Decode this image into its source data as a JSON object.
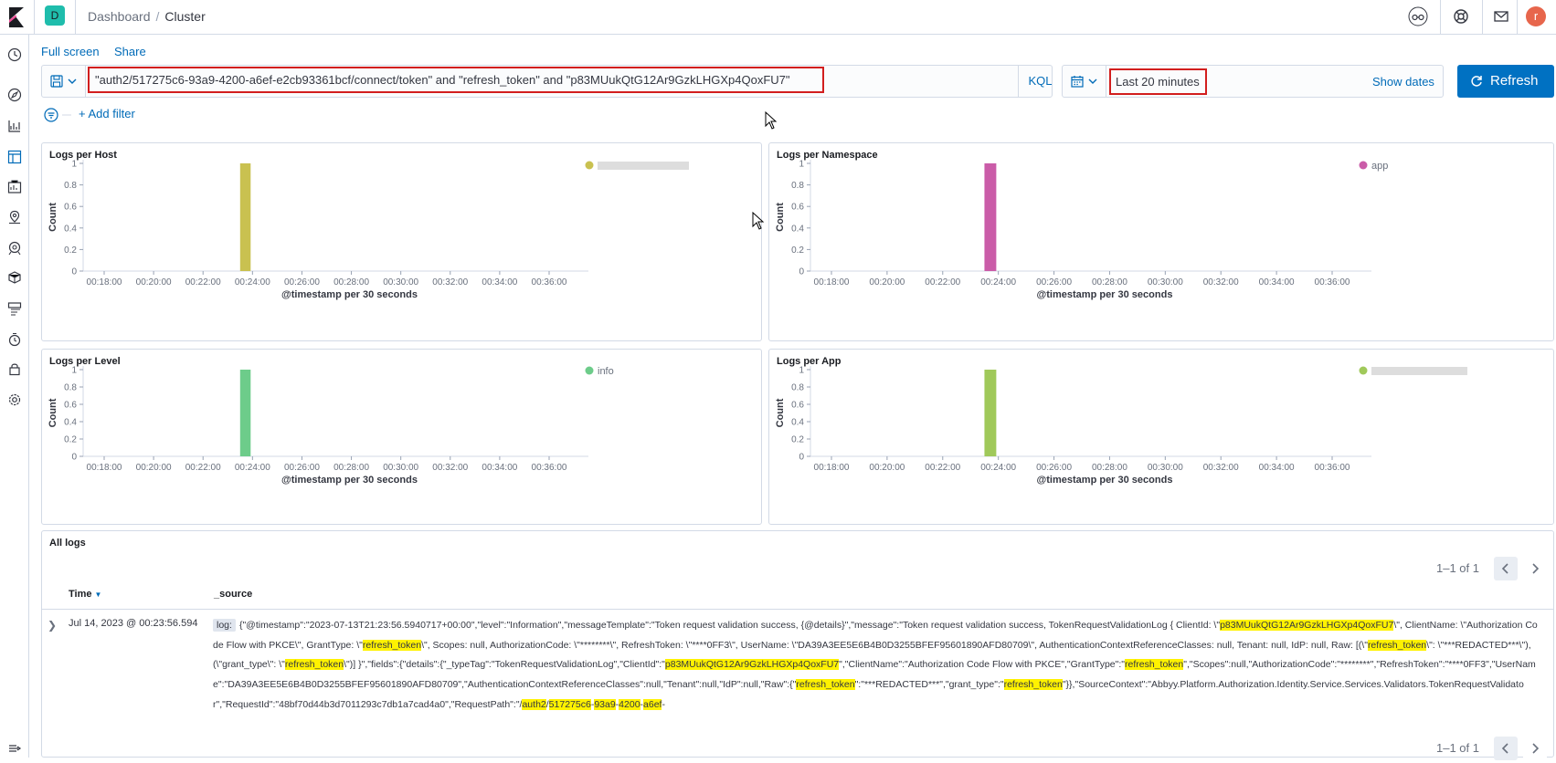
{
  "header": {
    "space_initial": "D",
    "breadcrumb_root": "Dashboard",
    "breadcrumb_sep": "/",
    "breadcrumb_current": "Cluster",
    "user_initial": "r"
  },
  "toolbar": {
    "full_screen": "Full screen",
    "share": "Share"
  },
  "query": {
    "text": "\"auth2/517275c6-93a9-4200-a6ef-e2cb93361bcf/connect/token\" and \"refresh_token\" and \"p83MUukQtG12Ar9GzkLHGXp4QoxFU7\"",
    "language": "KQL"
  },
  "time": {
    "range": "Last 20 minutes",
    "show_dates": "Show dates",
    "refresh_label": "Refresh"
  },
  "filters": {
    "add_filter": "+ Add filter"
  },
  "chart_data": [
    {
      "type": "bar",
      "title": "Logs per Host",
      "xlabel": "@timestamp per 30 seconds",
      "ylabel": "Count",
      "ylim": [
        0,
        1
      ],
      "yticks": [
        "1",
        "0.8",
        "0.6",
        "0.4",
        "0.2",
        "0"
      ],
      "xticks": [
        "00:18:00",
        "00:20:00",
        "00:22:00",
        "00:24:00",
        "00:26:00",
        "00:28:00",
        "00:30:00",
        "00:32:00",
        "00:34:00",
        "00:36:00"
      ],
      "series": [
        {
          "name": "",
          "x": "00:23:30",
          "values": [
            1
          ],
          "color": "#c9c150",
          "legend_blurred": true
        }
      ]
    },
    {
      "type": "bar",
      "title": "Logs per Namespace",
      "xlabel": "@timestamp per 30 seconds",
      "ylabel": "Count",
      "ylim": [
        0,
        1
      ],
      "yticks": [
        "1",
        "0.8",
        "0.6",
        "0.4",
        "0.2",
        "0"
      ],
      "xticks": [
        "00:18:00",
        "00:20:00",
        "00:22:00",
        "00:24:00",
        "00:26:00",
        "00:28:00",
        "00:30:00",
        "00:32:00",
        "00:34:00",
        "00:36:00"
      ],
      "series": [
        {
          "name": "app",
          "x": "00:23:30",
          "values": [
            1
          ],
          "color": "#ca5ca8",
          "legend_blurred": false
        }
      ]
    },
    {
      "type": "bar",
      "title": "Logs per Level",
      "xlabel": "@timestamp per 30 seconds",
      "ylabel": "Count",
      "ylim": [
        0,
        1
      ],
      "yticks": [
        "1",
        "0.8",
        "0.6",
        "0.4",
        "0.2",
        "0"
      ],
      "xticks": [
        "00:18:00",
        "00:20:00",
        "00:22:00",
        "00:24:00",
        "00:26:00",
        "00:28:00",
        "00:30:00",
        "00:32:00",
        "00:34:00",
        "00:36:00"
      ],
      "series": [
        {
          "name": "info",
          "x": "00:23:30",
          "values": [
            1
          ],
          "color": "#6dcc8a",
          "legend_blurred": false
        }
      ]
    },
    {
      "type": "bar",
      "title": "Logs per App",
      "xlabel": "@timestamp per 30 seconds",
      "ylabel": "Count",
      "ylim": [
        0,
        1
      ],
      "yticks": [
        "1",
        "0.8",
        "0.6",
        "0.4",
        "0.2",
        "0"
      ],
      "xticks": [
        "00:18:00",
        "00:20:00",
        "00:22:00",
        "00:24:00",
        "00:26:00",
        "00:28:00",
        "00:30:00",
        "00:32:00",
        "00:34:00",
        "00:36:00"
      ],
      "series": [
        {
          "name": "",
          "x": "00:23:30",
          "values": [
            1
          ],
          "color": "#a0c95a",
          "legend_blurred": true
        }
      ]
    }
  ],
  "logs": {
    "title": "All logs",
    "pager": "1–1 of 1",
    "col_time": "Time",
    "col_source": "_source",
    "row_time": "Jul 14, 2023 @ 00:23:56.594",
    "source_label": "log:",
    "source_segments": [
      {
        "t": "{\"@timestamp\":\"2023-07-13T21:23:56.5940717+00:00\",\"level\":\"Information\",\"messageTemplate\":\"Token request validation success, {@details}\",\"message\":\"Token request validation success, TokenRequestValidationLog { ClientId: \\\"",
        "h": false
      },
      {
        "t": "p83MUukQtG12Ar9GzkLHGXp4QoxFU7",
        "h": true
      },
      {
        "t": "\\\", ClientName: \\\"Authorization Code Flow with PKCE\\\", GrantType: \\\"",
        "h": false
      },
      {
        "t": "refresh_token",
        "h": true
      },
      {
        "t": "\\\", Scopes: null, AuthorizationCode: \\\"********\\\", RefreshToken: \\\"****0FF3\\\", UserName: \\\"DA39A3EE5E6B4B0D3255BFEF95601890AFD80709\\\", AuthenticationContextReferenceClasses: null, Tenant: null, IdP: null, Raw: [(\\\"",
        "h": false
      },
      {
        "t": "refresh_token",
        "h": true
      },
      {
        "t": "\\\": \\\"***REDACTED***\\\"), (\\\"grant_type\\\": \\\"",
        "h": false
      },
      {
        "t": "refresh_token",
        "h": true
      },
      {
        "t": "\\\")] }\",\"fields\":{\"details\":{\"_typeTag\":\"TokenRequestValidationLog\",\"ClientId\":\"",
        "h": false
      },
      {
        "t": "p83MUukQtG12Ar9GzkLHGXp4QoxFU7",
        "h": true
      },
      {
        "t": "\",\"ClientName\":\"Authorization Code Flow with PKCE\",\"GrantType\":\"",
        "h": false
      },
      {
        "t": "refresh_token",
        "h": true
      },
      {
        "t": "\",\"Scopes\":null,\"AuthorizationCode\":\"********\",\"RefreshToken\":\"****0FF3\",\"UserName\":\"DA39A3EE5E6B4B0D3255BFEF95601890AFD80709\",\"AuthenticationContextReferenceClasses\":null,\"Tenant\":null,\"IdP\":null,\"Raw\":{\"",
        "h": false
      },
      {
        "t": "refresh_token",
        "h": true
      },
      {
        "t": "\":\"***REDACTED***\",\"grant_type\":\"",
        "h": false
      },
      {
        "t": "refresh_token",
        "h": true
      },
      {
        "t": "\"}},\"SourceContext\":\"Abbyy.Platform.Authorization.Identity.Service.Services.Validators.TokenRequestValidator\",\"RequestId\":\"48bf70d44b3d7011293c7db1a7cad4a0\",\"RequestPath\":\"/",
        "h": false
      },
      {
        "t": "auth2",
        "h": true
      },
      {
        "t": "/",
        "h": false
      },
      {
        "t": "517275c6",
        "h": true
      },
      {
        "t": "-",
        "h": false
      },
      {
        "t": "93a9",
        "h": true
      },
      {
        "t": "-",
        "h": false
      },
      {
        "t": "4200",
        "h": true
      },
      {
        "t": "-",
        "h": false
      },
      {
        "t": "a6ef",
        "h": true
      },
      {
        "t": "-",
        "h": false
      }
    ]
  },
  "colors": {
    "accent": "#006bb8",
    "primary_button": "#0071c2",
    "highlight": "#fff200",
    "annotation_red": "#d21e1e"
  }
}
